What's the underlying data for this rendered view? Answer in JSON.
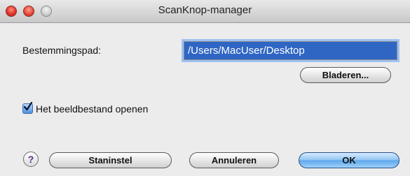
{
  "window": {
    "title": "ScanKnop-manager"
  },
  "destination": {
    "label": "Bestemmingspad:",
    "value": "/Users/MacUser/Desktop",
    "browse_label": "Bladeren..."
  },
  "options": {
    "open_image_label": "Het beeldbestand openen",
    "open_image_checked": true
  },
  "footer": {
    "help_label": "?",
    "defaults_label": "Staninstel",
    "cancel_label": "Annuleren",
    "ok_label": "OK"
  },
  "colors": {
    "selection": "#2f66c4",
    "focus_ring": "#9fc1f2",
    "default_button": "#5da6ea"
  }
}
